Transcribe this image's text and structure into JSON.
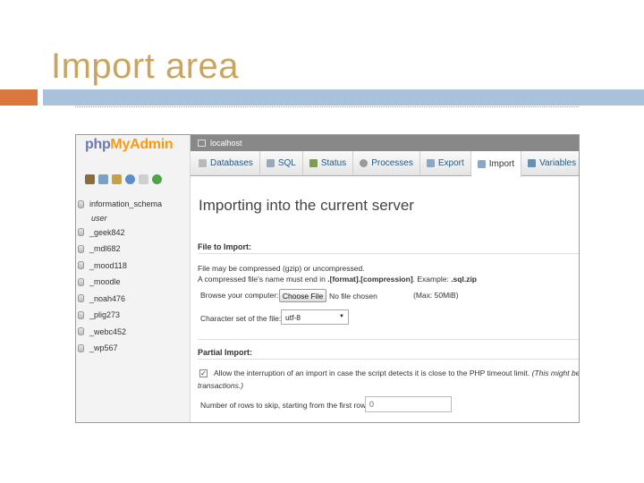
{
  "slide": {
    "title": "Import area",
    "colors": {
      "title": "#c9a55f",
      "accent_orange": "#d9773f",
      "accent_blue": "#a9c2db"
    }
  },
  "nav": {
    "logo": {
      "php": "php",
      "my": "My",
      "admin": "Admin"
    },
    "icons": [
      "home-icon",
      "sql-window-icon",
      "logout-icon",
      "docs-icon",
      "settings-icon",
      "reload-icon"
    ],
    "databases": [
      {
        "name": "information_schema",
        "sub": "user"
      },
      {
        "name": "_geek842"
      },
      {
        "name": "_mdl682"
      },
      {
        "name": "_mood118"
      },
      {
        "name": "_moodle"
      },
      {
        "name": "_noah476"
      },
      {
        "name": "_plig273"
      },
      {
        "name": "_webc452"
      },
      {
        "name": "_wp567"
      }
    ]
  },
  "serverbar": {
    "label": "localhost"
  },
  "tabs": [
    {
      "label": "Databases",
      "icon": "databases-icon"
    },
    {
      "label": "SQL",
      "icon": "sql-icon"
    },
    {
      "label": "Status",
      "icon": "status-icon"
    },
    {
      "label": "Processes",
      "icon": "processes-icon"
    },
    {
      "label": "Export",
      "icon": "export-icon"
    },
    {
      "label": "Import",
      "icon": "import-icon",
      "active": true
    },
    {
      "label": "Variables",
      "icon": "variables-icon"
    }
  ],
  "content": {
    "heading": "Importing into the current server",
    "file_section": {
      "title": "File to Import:",
      "line1": "File may be compressed (gzip) or uncompressed.",
      "line2_prefix": "A compressed file's name must end in ",
      "line2_bold": ".[format].[compression]",
      "line2_mid": ". Example: ",
      "line2_example": ".sql.zip",
      "browse_label": "Browse your computer:",
      "choose_button": "Choose File",
      "no_file": "No file chosen",
      "max_size": "(Max: 50MiB)",
      "charset_label": "Character set of the file:",
      "charset_value": "utf-8"
    },
    "partial_section": {
      "title": "Partial Import:",
      "allow_interrupt": "Allow the interruption of an import in case the script detects it is close to the PHP timeout limit.",
      "allow_note": "(This might be goo",
      "allow_note2": "transactions.)",
      "checked": true,
      "skip_label": "Number of rows to skip, starting from the first row:",
      "skip_value": "0"
    }
  }
}
